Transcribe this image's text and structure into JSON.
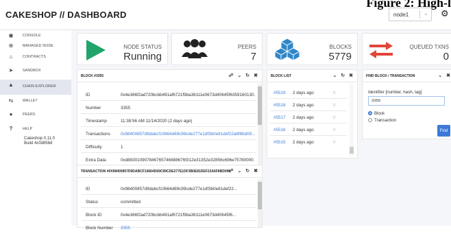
{
  "figure_caption": "Figure 2: High-l",
  "header": {
    "title": "CAKESHOP // DASHBOARD",
    "node_select": "node1"
  },
  "sidebar": {
    "items": [
      {
        "label": "CONSOLE"
      },
      {
        "label": "MANAGED NODE"
      },
      {
        "label": "CONTRACTS"
      },
      {
        "label": "SANDBOX"
      },
      {
        "label": "CHAIN EXPLORER"
      },
      {
        "label": "WALLET"
      },
      {
        "label": "PEERS"
      },
      {
        "label": "HELP"
      }
    ],
    "version": "Cakeshop 0.11.0",
    "build": "Build 4c0d856d"
  },
  "stats": {
    "node_status": {
      "label": "NODE STATUS",
      "value": "Running"
    },
    "peers": {
      "label": "PEERS",
      "value": "7"
    },
    "blocks": {
      "label": "BLOCKS",
      "value": "5779"
    },
    "queued": {
      "label": "QUEUED TXNS",
      "value": "0"
    }
  },
  "block_panel": {
    "title": "BLOCK #3355",
    "rows": [
      {
        "k": "ID",
        "v": "0x4e366f2ad720bcbb491af6721f9ba36111e0673d40645f6359160130..."
      },
      {
        "k": "Number",
        "v": "3355"
      },
      {
        "k": "Timestamp",
        "v": "11:38:56 AM 11/14/2020 (2 days ago)"
      },
      {
        "k": "Transactions",
        "v": "0x98400857d9dabcf10664d69c99cde277e1df3b0e81def22a6f8bd09..."
      },
      {
        "k": "Difficulty",
        "v": "1"
      },
      {
        "k": "Extra Data",
        "v": "0xd883010907846765746888676f312e31352e32856c696e75780000..."
      }
    ]
  },
  "block_list": {
    "title": "BLOCK LIST",
    "rows": [
      {
        "n": "#5519",
        "d": "2 days ago",
        "z": "0"
      },
      {
        "n": "#5518",
        "d": "2 days ago",
        "z": "0"
      },
      {
        "n": "#5517",
        "d": "2 days ago",
        "z": "0"
      },
      {
        "n": "#5516",
        "d": "2 days ago",
        "z": "0"
      },
      {
        "n": "#5515",
        "d": "2 days ago",
        "z": "0"
      }
    ]
  },
  "find_panel": {
    "title": "FIND BLOCK / TRANSACTION",
    "label": "Identifier [number, hash, tag]",
    "value": "3355",
    "radio_block": "Block",
    "radio_tx": "Transaction",
    "button": "Find"
  },
  "tx_panel": {
    "title": "TRANSACTION #0X98400857D9DABCF10664D69C99CDE277E1DF3B0E81DEF22A6F8BD09E4...",
    "rows": [
      {
        "k": "ID",
        "v": "0x98400857d9dabcf10664d69c99cde277e1df3b0e81def22..."
      },
      {
        "k": "Status",
        "v": "committed"
      },
      {
        "k": "Block ID",
        "v": "0x4e366f2ad720bcbb491af6721f9ba36111e0673d40645f6..."
      },
      {
        "k": "Block Number",
        "v": "3355"
      }
    ]
  },
  "icons": {
    "accent": "#3c7ad9",
    "play": "#1fa56b",
    "arrows": "#e0463a",
    "cubes": "#2f87c8"
  }
}
